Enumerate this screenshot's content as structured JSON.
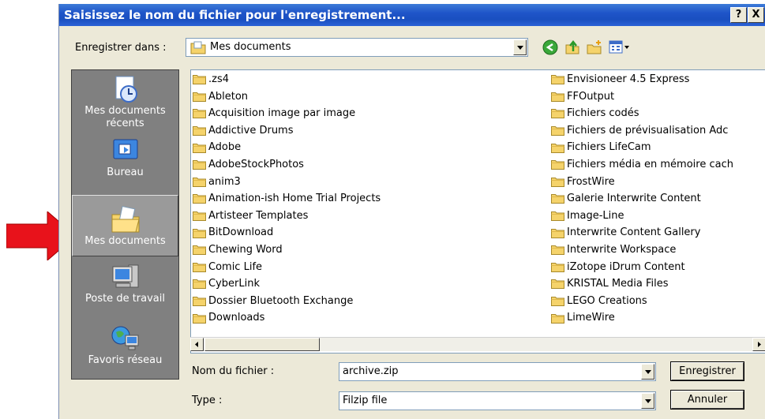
{
  "dialog": {
    "title": "Saisissez le nom du fichier pour l'enregistrement...",
    "help_label": "?",
    "close_label": "X"
  },
  "save_in": {
    "label": "Enregistrer dans :",
    "value": "Mes documents"
  },
  "toolbar": {
    "icons": [
      "back-icon",
      "up-folder-icon",
      "new-folder-icon",
      "view-menu-icon"
    ]
  },
  "places": [
    {
      "label": "Mes documents récents",
      "icon": "recent-documents-icon"
    },
    {
      "label": "Bureau",
      "icon": "desktop-icon"
    },
    {
      "label": "Mes documents",
      "icon": "my-documents-icon",
      "selected": true
    },
    {
      "label": "Poste de travail",
      "icon": "my-computer-icon"
    },
    {
      "label": "Favoris réseau",
      "icon": "network-places-icon"
    }
  ],
  "files_left": [
    ".zs4",
    "Ableton",
    "Acquisition image par image",
    "Addictive Drums",
    "Adobe",
    "AdobeStockPhotos",
    "anim3",
    "Animation-ish Home Trial Projects",
    "Artisteer Templates",
    "BitDownload",
    "Chewing Word",
    "Comic Life",
    "CyberLink",
    "Dossier Bluetooth Exchange",
    "Downloads"
  ],
  "files_right": [
    "Envisioneer 4.5 Express",
    "FFOutput",
    "Fichiers codés",
    "Fichiers de prévisualisation Adc",
    "Fichiers LifeCam",
    "Fichiers média en mémoire cach",
    "FrostWire",
    "Galerie Interwrite Content",
    "Image-Line",
    "Interwrite Content Gallery",
    "Interwrite Workspace",
    "iZotope iDrum Content",
    "KRISTAL Media Files",
    "LEGO Creations",
    "LimeWire"
  ],
  "filename": {
    "label": "Nom du fichier :",
    "value": "archive.zip"
  },
  "filetype": {
    "label": "Type :",
    "value": "Filzip file"
  },
  "buttons": {
    "save": "Enregistrer",
    "cancel": "Annuler"
  },
  "colors": {
    "title_bar": "#1f55c9",
    "dialog_bg": "#ece9d8",
    "places_bg": "#808080",
    "arrow": "#e8121b",
    "folder": "#f5d36b"
  }
}
